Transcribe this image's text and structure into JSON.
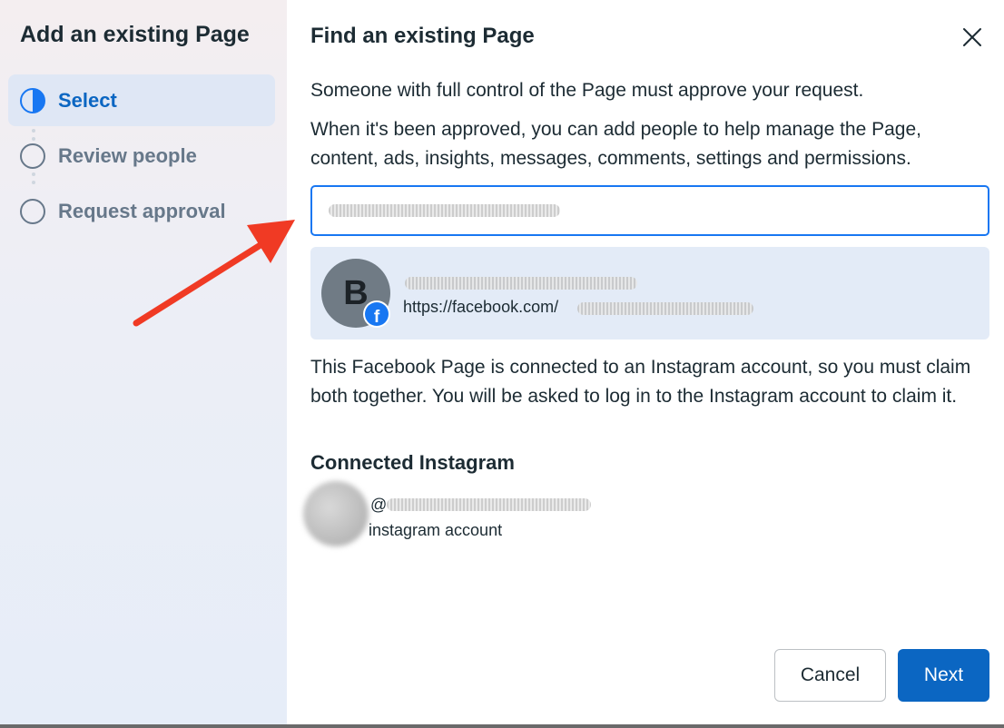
{
  "sidebar": {
    "title": "Add an existing Page",
    "steps": [
      {
        "label": "Select",
        "state": "active"
      },
      {
        "label": "Review people",
        "state": "pending"
      },
      {
        "label": "Request approval",
        "state": "pending"
      }
    ]
  },
  "dialog": {
    "title": "Find an existing Page",
    "intro_line1": "Someone with full control of the Page must approve your request.",
    "intro_line2": "When it's been approved, you can add people to help manage the Page, content, ads, insights, messages, comments, settings and permissions.",
    "search": {
      "value": ""
    },
    "result": {
      "avatar_initial": "B",
      "url_prefix": "https://facebook.com/",
      "badge_icon": "facebook-badge-icon"
    },
    "notice": "This Facebook Page is connected to an Instagram account, so you must claim both together. You will be asked to log in to the Instagram account to claim it.",
    "connected_title": "Connected Instagram",
    "instagram": {
      "handle_prefix": "@",
      "type": "instagram account"
    },
    "buttons": {
      "cancel": "Cancel",
      "next": "Next"
    }
  },
  "colors": {
    "accent": "#1877f2",
    "primary_button": "#0b66c2",
    "annotation_arrow": "#f03a24",
    "result_bg": "#e3ebf7"
  }
}
